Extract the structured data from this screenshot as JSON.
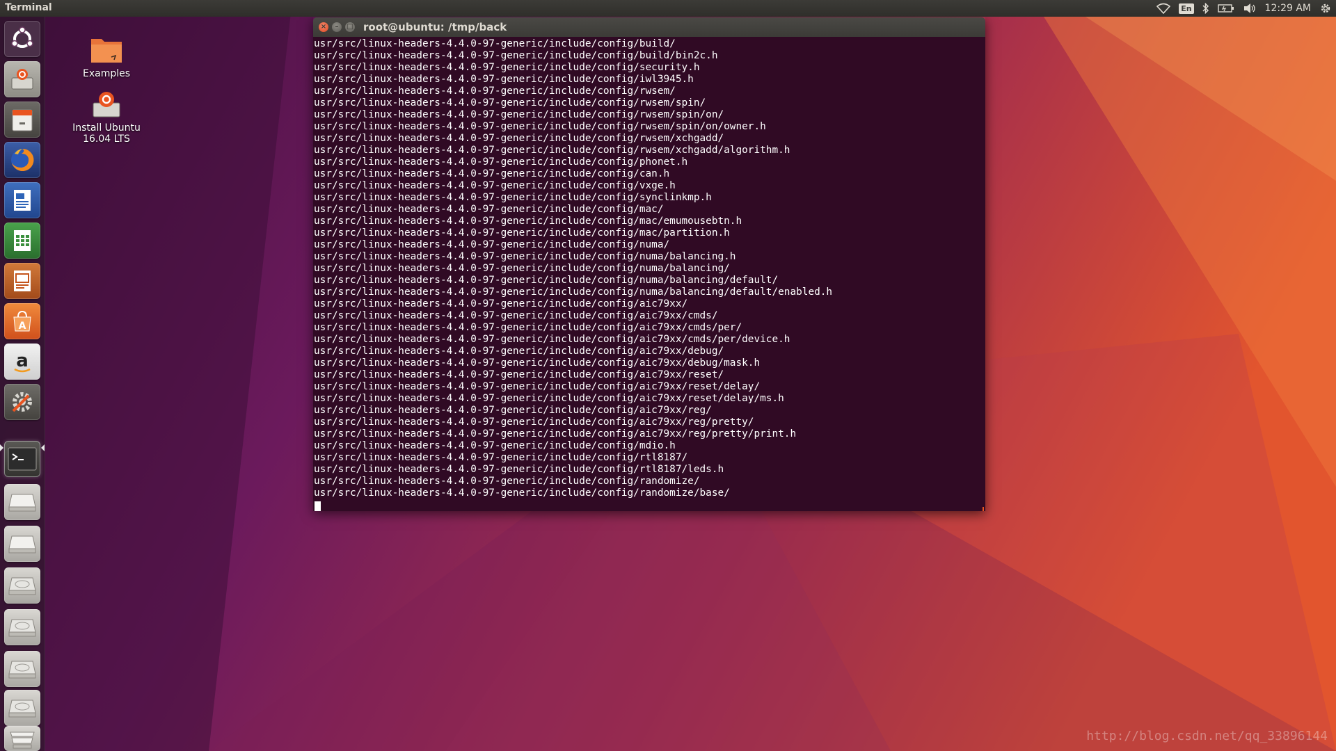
{
  "top_panel": {
    "title": "Terminal",
    "keyboard_layout": "En",
    "clock": "12:29 AM",
    "icons": [
      "wifi-icon",
      "keyboard-icon",
      "bluetooth-icon",
      "battery-icon",
      "volume-icon",
      "settings-gear-icon"
    ]
  },
  "launcher": {
    "items": [
      {
        "name": "dash-home",
        "icon": "ubuntu-logo-icon"
      },
      {
        "name": "install-ubuntu",
        "icon": "installer-icon"
      },
      {
        "name": "files",
        "icon": "file-cabinet-icon"
      },
      {
        "name": "firefox",
        "icon": "firefox-icon"
      },
      {
        "name": "libreoffice-writer",
        "icon": "writer-document-icon"
      },
      {
        "name": "libreoffice-calc",
        "icon": "calc-spreadsheet-icon"
      },
      {
        "name": "libreoffice-impress",
        "icon": "impress-presentation-icon"
      },
      {
        "name": "ubuntu-software",
        "icon": "software-center-icon"
      },
      {
        "name": "amazon",
        "icon": "amazon-icon"
      },
      {
        "name": "system-settings",
        "icon": "system-settings-icon"
      },
      {
        "name": "terminal",
        "icon": "terminal-icon",
        "active": true
      },
      {
        "name": "drive-1",
        "icon": "hard-drive-icon"
      },
      {
        "name": "drive-2",
        "icon": "hard-drive-icon"
      },
      {
        "name": "drive-3",
        "icon": "hard-drive-icon"
      },
      {
        "name": "drive-4",
        "icon": "hard-drive-icon"
      },
      {
        "name": "drive-5",
        "icon": "hard-drive-icon"
      },
      {
        "name": "drive-6",
        "icon": "hard-drive-icon"
      },
      {
        "name": "trash",
        "icon": "trash-icon"
      }
    ]
  },
  "desktop": {
    "icons": [
      {
        "label": "Examples",
        "icon": "folder-icon"
      },
      {
        "label_line1": "Install Ubuntu",
        "label_line2": "16.04 LTS",
        "icon": "installer-icon"
      }
    ]
  },
  "terminal": {
    "title": "root@ubuntu: /tmp/back",
    "lines": [
      "usr/src/linux-headers-4.4.0-97-generic/include/config/build/",
      "usr/src/linux-headers-4.4.0-97-generic/include/config/build/bin2c.h",
      "usr/src/linux-headers-4.4.0-97-generic/include/config/security.h",
      "usr/src/linux-headers-4.4.0-97-generic/include/config/iwl3945.h",
      "usr/src/linux-headers-4.4.0-97-generic/include/config/rwsem/",
      "usr/src/linux-headers-4.4.0-97-generic/include/config/rwsem/spin/",
      "usr/src/linux-headers-4.4.0-97-generic/include/config/rwsem/spin/on/",
      "usr/src/linux-headers-4.4.0-97-generic/include/config/rwsem/spin/on/owner.h",
      "usr/src/linux-headers-4.4.0-97-generic/include/config/rwsem/xchgadd/",
      "usr/src/linux-headers-4.4.0-97-generic/include/config/rwsem/xchgadd/algorithm.h",
      "usr/src/linux-headers-4.4.0-97-generic/include/config/phonet.h",
      "usr/src/linux-headers-4.4.0-97-generic/include/config/can.h",
      "usr/src/linux-headers-4.4.0-97-generic/include/config/vxge.h",
      "usr/src/linux-headers-4.4.0-97-generic/include/config/synclinkmp.h",
      "usr/src/linux-headers-4.4.0-97-generic/include/config/mac/",
      "usr/src/linux-headers-4.4.0-97-generic/include/config/mac/emumousebtn.h",
      "usr/src/linux-headers-4.4.0-97-generic/include/config/mac/partition.h",
      "usr/src/linux-headers-4.4.0-97-generic/include/config/numa/",
      "usr/src/linux-headers-4.4.0-97-generic/include/config/numa/balancing.h",
      "usr/src/linux-headers-4.4.0-97-generic/include/config/numa/balancing/",
      "usr/src/linux-headers-4.4.0-97-generic/include/config/numa/balancing/default/",
      "usr/src/linux-headers-4.4.0-97-generic/include/config/numa/balancing/default/enabled.h",
      "usr/src/linux-headers-4.4.0-97-generic/include/config/aic79xx/",
      "usr/src/linux-headers-4.4.0-97-generic/include/config/aic79xx/cmds/",
      "usr/src/linux-headers-4.4.0-97-generic/include/config/aic79xx/cmds/per/",
      "usr/src/linux-headers-4.4.0-97-generic/include/config/aic79xx/cmds/per/device.h",
      "usr/src/linux-headers-4.4.0-97-generic/include/config/aic79xx/debug/",
      "usr/src/linux-headers-4.4.0-97-generic/include/config/aic79xx/debug/mask.h",
      "usr/src/linux-headers-4.4.0-97-generic/include/config/aic79xx/reset/",
      "usr/src/linux-headers-4.4.0-97-generic/include/config/aic79xx/reset/delay/",
      "usr/src/linux-headers-4.4.0-97-generic/include/config/aic79xx/reset/delay/ms.h",
      "usr/src/linux-headers-4.4.0-97-generic/include/config/aic79xx/reg/",
      "usr/src/linux-headers-4.4.0-97-generic/include/config/aic79xx/reg/pretty/",
      "usr/src/linux-headers-4.4.0-97-generic/include/config/aic79xx/reg/pretty/print.h",
      "usr/src/linux-headers-4.4.0-97-generic/include/config/mdio.h",
      "usr/src/linux-headers-4.4.0-97-generic/include/config/rtl8187/",
      "usr/src/linux-headers-4.4.0-97-generic/include/config/rtl8187/leds.h",
      "usr/src/linux-headers-4.4.0-97-generic/include/config/randomize/",
      "usr/src/linux-headers-4.4.0-97-generic/include/config/randomize/base/"
    ]
  },
  "watermark": "http://blog.csdn.net/qq_33896144",
  "colors": {
    "terminal_bg": "#300a24",
    "terminal_fg": "#ffffff",
    "accent": "#e95420",
    "panel_bg": "#3c3b37"
  }
}
